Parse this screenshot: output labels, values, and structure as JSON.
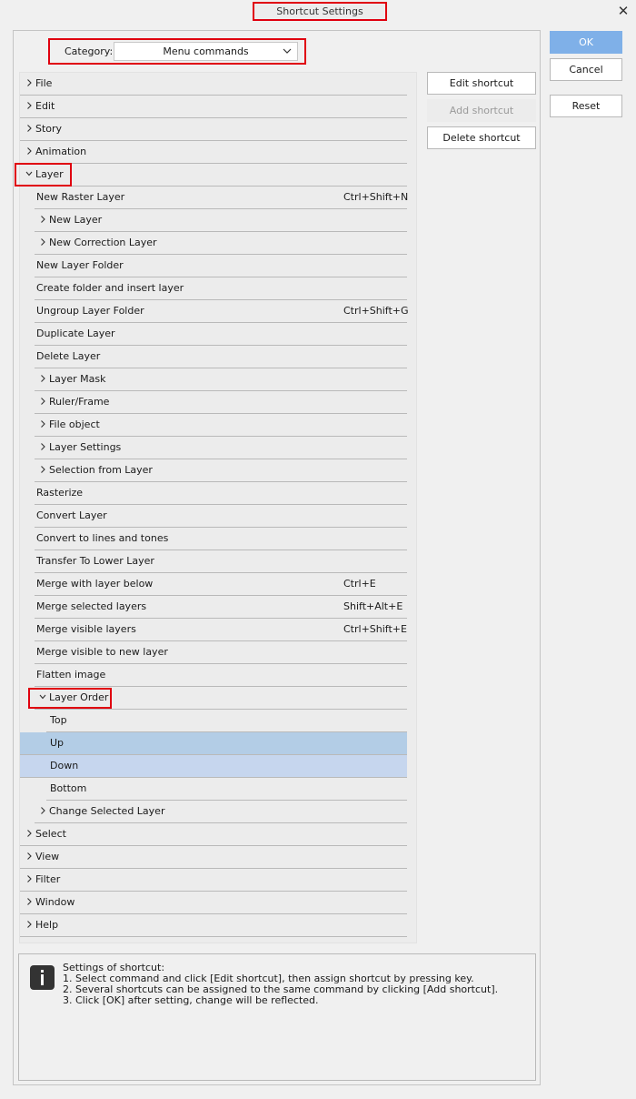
{
  "window": {
    "title": "Shortcut Settings",
    "close_glyph": "✕"
  },
  "category": {
    "label": "Category:",
    "value": "Menu commands"
  },
  "buttons": {
    "edit": "Edit shortcut",
    "add": "Add shortcut",
    "delete": "Delete shortcut",
    "ok": "OK",
    "cancel": "Cancel",
    "reset": "Reset"
  },
  "tree": [
    {
      "label": "File",
      "level": 1,
      "arrow": "collapsed",
      "shortcut": ""
    },
    {
      "label": "Edit",
      "level": 1,
      "arrow": "collapsed",
      "shortcut": ""
    },
    {
      "label": "Story",
      "level": 1,
      "arrow": "collapsed",
      "shortcut": ""
    },
    {
      "label": "Animation",
      "level": 1,
      "arrow": "collapsed",
      "shortcut": ""
    },
    {
      "label": "Layer",
      "level": 1,
      "arrow": "expanded",
      "shortcut": ""
    },
    {
      "label": "New Raster Layer",
      "level": 2,
      "arrow": "none",
      "shortcut": "Ctrl+Shift+N"
    },
    {
      "label": "New Layer",
      "level": 2,
      "arrow": "collapsed",
      "shortcut": ""
    },
    {
      "label": "New Correction Layer",
      "level": 2,
      "arrow": "collapsed",
      "shortcut": ""
    },
    {
      "label": "New Layer Folder",
      "level": 2,
      "arrow": "none",
      "shortcut": ""
    },
    {
      "label": "Create folder and insert layer",
      "level": 2,
      "arrow": "none",
      "shortcut": ""
    },
    {
      "label": "Ungroup Layer Folder",
      "level": 2,
      "arrow": "none",
      "shortcut": "Ctrl+Shift+G"
    },
    {
      "label": "Duplicate Layer",
      "level": 2,
      "arrow": "none",
      "shortcut": ""
    },
    {
      "label": "Delete Layer",
      "level": 2,
      "arrow": "none",
      "shortcut": ""
    },
    {
      "label": "Layer Mask",
      "level": 2,
      "arrow": "collapsed",
      "shortcut": ""
    },
    {
      "label": "Ruler/Frame",
      "level": 2,
      "arrow": "collapsed",
      "shortcut": ""
    },
    {
      "label": "File object",
      "level": 2,
      "arrow": "collapsed",
      "shortcut": ""
    },
    {
      "label": "Layer Settings",
      "level": 2,
      "arrow": "collapsed",
      "shortcut": ""
    },
    {
      "label": "Selection from Layer",
      "level": 2,
      "arrow": "collapsed",
      "shortcut": ""
    },
    {
      "label": "Rasterize",
      "level": 2,
      "arrow": "none",
      "shortcut": ""
    },
    {
      "label": "Convert Layer",
      "level": 2,
      "arrow": "none",
      "shortcut": ""
    },
    {
      "label": "Convert to lines and tones",
      "level": 2,
      "arrow": "none",
      "shortcut": ""
    },
    {
      "label": "Transfer To Lower Layer",
      "level": 2,
      "arrow": "none",
      "shortcut": ""
    },
    {
      "label": "Merge with layer below",
      "level": 2,
      "arrow": "none",
      "shortcut": "Ctrl+E"
    },
    {
      "label": "Merge selected layers",
      "level": 2,
      "arrow": "none",
      "shortcut": "Shift+Alt+E"
    },
    {
      "label": "Merge visible layers",
      "level": 2,
      "arrow": "none",
      "shortcut": "Ctrl+Shift+E"
    },
    {
      "label": "Merge visible to new layer",
      "level": 2,
      "arrow": "none",
      "shortcut": ""
    },
    {
      "label": "Flatten image",
      "level": 2,
      "arrow": "none",
      "shortcut": ""
    },
    {
      "label": "Layer Order",
      "level": 2,
      "arrow": "expanded",
      "shortcut": ""
    },
    {
      "label": "Top",
      "level": 3,
      "arrow": "none",
      "shortcut": ""
    },
    {
      "label": "Up",
      "level": 3,
      "arrow": "none",
      "shortcut": "",
      "selected": "a"
    },
    {
      "label": "Down",
      "level": 3,
      "arrow": "none",
      "shortcut": "",
      "selected": "b"
    },
    {
      "label": "Bottom",
      "level": 3,
      "arrow": "none",
      "shortcut": ""
    },
    {
      "label": "Change Selected Layer",
      "level": 2,
      "arrow": "collapsed",
      "shortcut": ""
    },
    {
      "label": "Select",
      "level": 1,
      "arrow": "collapsed",
      "shortcut": ""
    },
    {
      "label": "View",
      "level": 1,
      "arrow": "collapsed",
      "shortcut": ""
    },
    {
      "label": "Filter",
      "level": 1,
      "arrow": "collapsed",
      "shortcut": ""
    },
    {
      "label": "Window",
      "level": 1,
      "arrow": "collapsed",
      "shortcut": ""
    },
    {
      "label": "Help",
      "level": 1,
      "arrow": "collapsed",
      "shortcut": ""
    }
  ],
  "info": {
    "icon": "info-icon",
    "heading": "Settings of shortcut:",
    "lines": [
      "1. Select command and click [Edit shortcut], then assign shortcut by pressing key.",
      "2. Several shortcuts can be assigned to the same command by clicking [Add shortcut].",
      "3. Click [OK] after setting, change will be reflected."
    ]
  },
  "colors": {
    "highlight_red": "#e0000f",
    "selection_up": "#b3cde6",
    "selection_down": "#c6d6ee",
    "ok_button": "#7fb0e8"
  }
}
